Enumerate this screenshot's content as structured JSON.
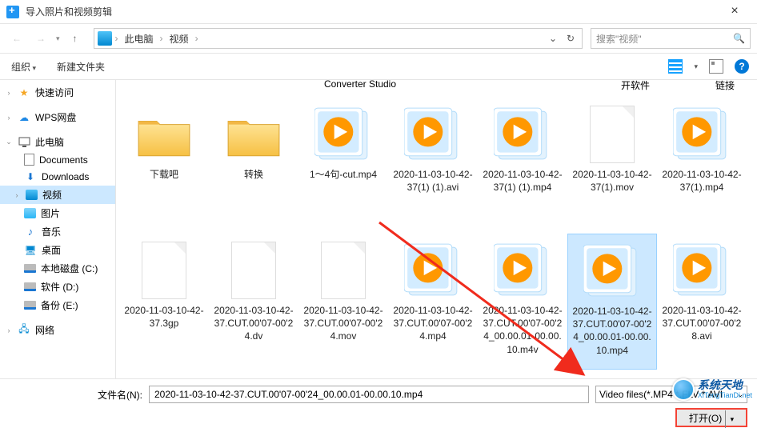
{
  "window": {
    "title": "导入照片和视频剪辑",
    "close": "×"
  },
  "nav": {
    "back": "←",
    "fwd": "→",
    "up": "↑",
    "crumbs": [
      "此电脑",
      "视频"
    ],
    "refresh": "↻",
    "search_placeholder": "搜索\"视频\""
  },
  "toolbar": {
    "organize": "组织",
    "newfolder": "新建文件夹",
    "help": "?"
  },
  "sidebar": {
    "quick": "快速访问",
    "wps": "WPS网盘",
    "pc": "此电脑",
    "docs": "Documents",
    "downloads": "Downloads",
    "videos": "视频",
    "pictures": "图片",
    "music": "音乐",
    "desktop": "桌面",
    "cdisk": "本地磁盘 (C:)",
    "ddisk": "软件 (D:)",
    "edisk": "备份 (E:)",
    "network": "网络"
  },
  "cut_labels": {
    "studio": "Converter Studio",
    "open_sw": "开软件",
    "link": "链接"
  },
  "files": [
    {
      "name": "下载吧",
      "type": "folder"
    },
    {
      "name": "转换",
      "type": "folder"
    },
    {
      "name": "1～4句-cut.mp4",
      "type": "video"
    },
    {
      "name": "2020-11-03-10-42-37(1) (1).avi",
      "type": "video"
    },
    {
      "name": "2020-11-03-10-42-37(1) (1).mp4",
      "type": "video"
    },
    {
      "name": "2020-11-03-10-42-37(1).mov",
      "type": "blank"
    },
    {
      "name": "2020-11-03-10-42-37(1).mp4",
      "type": "video"
    },
    {
      "name": "2020-11-03-10-42-37.3gp",
      "type": "blank"
    },
    {
      "name": "2020-11-03-10-42-37.CUT.00'07-00'24.dv",
      "type": "blank"
    },
    {
      "name": "2020-11-03-10-42-37.CUT.00'07-00'24.mov",
      "type": "blank"
    },
    {
      "name": "2020-11-03-10-42-37.CUT.00'07-00'24.mp4",
      "type": "video"
    },
    {
      "name": "2020-11-03-10-42-37.CUT.00'07-00'24_00.00.01-00.00.10.m4v",
      "type": "video"
    },
    {
      "name": "2020-11-03-10-42-37.CUT.00'07-00'24_00.00.01-00.00.10.mp4",
      "type": "video",
      "selected": true
    },
    {
      "name": "2020-11-03-10-42-37.CUT.00'07-00'28.avi",
      "type": "video"
    }
  ],
  "footer": {
    "fname_label": "文件名(N):",
    "fname_value": "2020-11-03-10-42-37.CUT.00'07-00'24_00.00.01-00.00.10.mp4",
    "filter": "Video files(*.MP4 *.FLV *.AVI",
    "open_btn": "打开(O)"
  },
  "watermark": {
    "cn": "系统天地",
    "en": "XiTongTianDi.net"
  }
}
